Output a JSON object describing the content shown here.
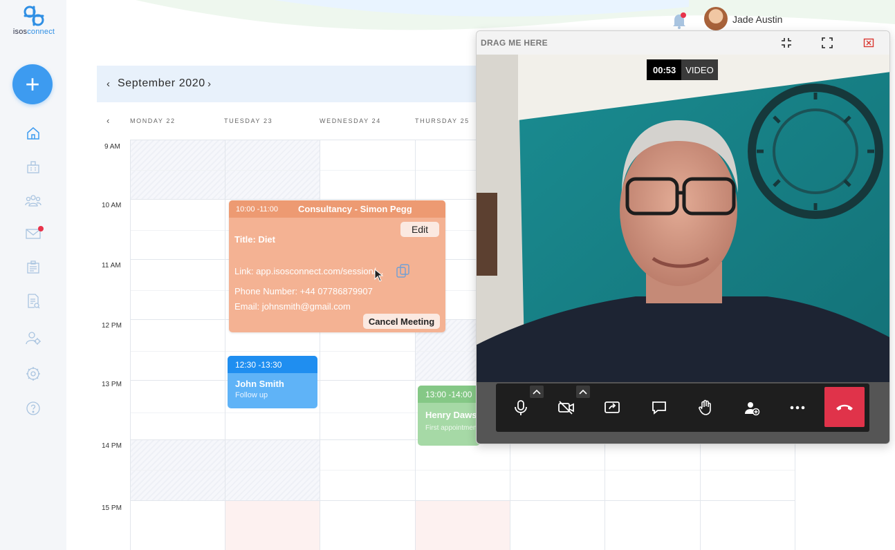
{
  "app": {
    "logo_text_prefix": "isos",
    "logo_text_suffix": "connect",
    "logo_icon": "isosconnect-logo"
  },
  "sidebar": {
    "add_label": "+",
    "items": [
      {
        "name": "home",
        "icon": "home-icon"
      },
      {
        "name": "clinic",
        "icon": "building-icon"
      },
      {
        "name": "clients",
        "icon": "users-icon"
      },
      {
        "name": "messages",
        "icon": "mail-icon",
        "has_notification": true
      },
      {
        "name": "sessions",
        "icon": "id-card-icon"
      },
      {
        "name": "reports",
        "icon": "document-search-icon"
      },
      {
        "name": "account",
        "icon": "user-settings-icon"
      },
      {
        "name": "settings",
        "icon": "gear-icon"
      },
      {
        "name": "help",
        "icon": "help-icon"
      }
    ],
    "accent": "#3d9bf0"
  },
  "header": {
    "user_name": "Jade Austin",
    "notification_dot": true
  },
  "calendar": {
    "month": "September 2020",
    "prev": "‹",
    "next": "›",
    "week_prev": "‹",
    "days": [
      "MONDAY 22",
      "TUESDAY 23",
      "WEDNESDAY 24",
      "THURSDAY 25"
    ],
    "hours": [
      "9 AM",
      "10 AM",
      "11 AM",
      "12 PM",
      "13 PM",
      "14 PM",
      "15 PM"
    ]
  },
  "events": {
    "consult": {
      "time": "10:00 -11:00",
      "title": "Consultancy - Simon Pegg",
      "edit": "Edit",
      "subject": "Title: Diet",
      "link": "Link: app.isosconnect.com/session/...",
      "phone": "Phone Number: +44 07786879907",
      "email": "Email: johnsmith@gmail.com",
      "cancel": "Cancel Meeting",
      "color": "#ed9a72"
    },
    "john": {
      "time": "12:30 -13:30",
      "name": "John Smith",
      "note": "Follow up",
      "color": "#1f8ef0"
    },
    "henry": {
      "time": "13:00 -14:00",
      "name": "Henry Daws",
      "note": "First appointment",
      "color": "#85c886"
    }
  },
  "video": {
    "drag_label": "DRAG ME HERE",
    "timer": "00:53",
    "mode": "VIDEO",
    "controls": [
      "microphone-icon",
      "camera-off-icon",
      "share-screen-icon",
      "chat-icon",
      "raise-hand-icon",
      "add-participant-icon",
      "more-icon",
      "hang-up-icon"
    ],
    "hangup_color": "#e0334a"
  }
}
